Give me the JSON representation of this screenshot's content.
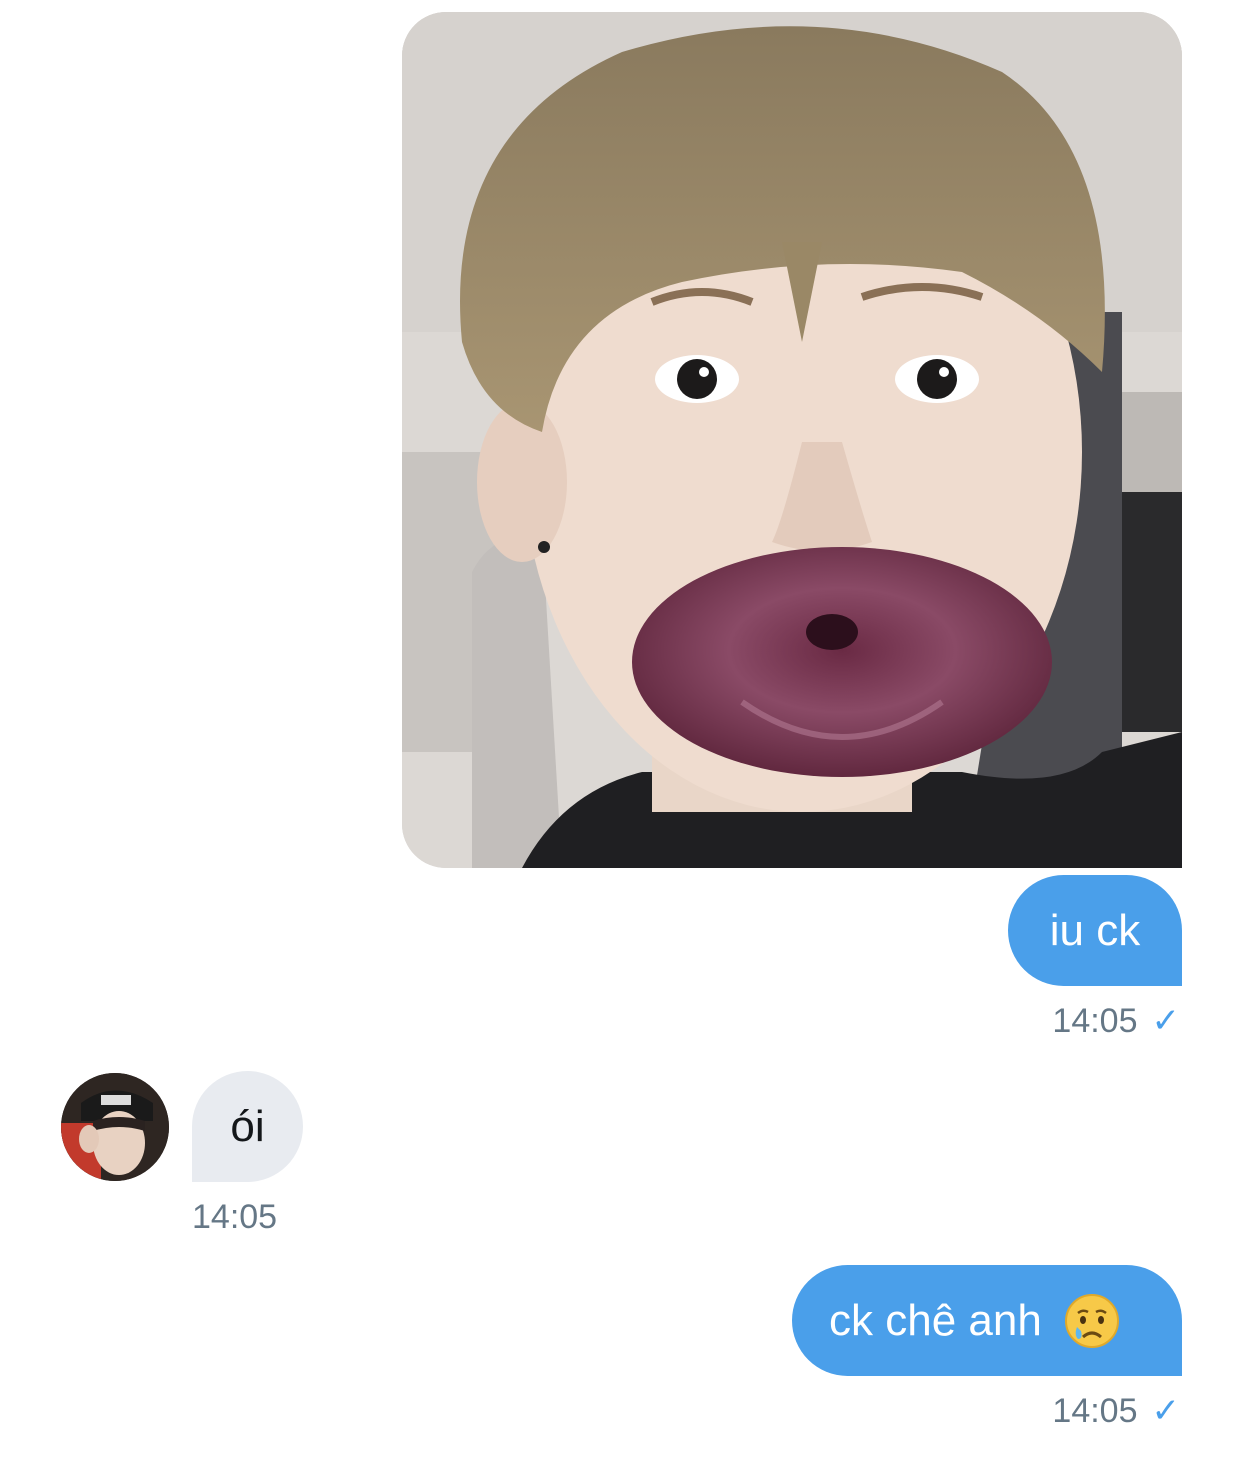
{
  "messages": [
    {
      "type": "image",
      "direction": "outgoing"
    },
    {
      "type": "text",
      "direction": "outgoing",
      "text": "iu ck",
      "time": "14:05",
      "status_icon": "check-icon"
    },
    {
      "type": "text",
      "direction": "incoming",
      "text": "ói",
      "time": "14:05"
    },
    {
      "type": "text",
      "direction": "outgoing",
      "text": "ck chê anh",
      "emoji": "crying-face",
      "time": "14:05",
      "status_icon": "check-icon"
    }
  ],
  "status_glyph": "✓",
  "colors": {
    "outgoing_bubble": "#4a9fea",
    "incoming_bubble": "#e8ebf0",
    "timestamp": "#657786",
    "background": "#ffffff"
  }
}
